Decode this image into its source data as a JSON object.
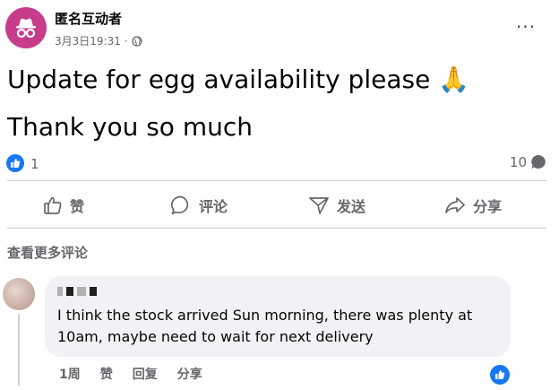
{
  "post": {
    "author": "匿名互动者",
    "timestamp": "3月3日19:31",
    "meta_separator": "·",
    "audience_icon": "globe-icon",
    "line1": "Update for egg availability please 🙏",
    "line2": "Thank you so much",
    "more_label": "···"
  },
  "stats": {
    "likes": "1",
    "comments": "10"
  },
  "actions": {
    "like": "赞",
    "comment": "评论",
    "send": "发送",
    "share": "分享"
  },
  "comments_section": {
    "view_more": "查看更多评论"
  },
  "comment": {
    "text": "I think the stock arrived Sun morning, there was plenty at 10am, maybe need to wait for next delivery",
    "time": "1周",
    "like": "赞",
    "reply": "回复",
    "share": "分享"
  },
  "colors": {
    "accent": "#1877f2",
    "avatar": "#c83c8c",
    "muted": "#65676b",
    "bubble": "#f0f2f5"
  }
}
